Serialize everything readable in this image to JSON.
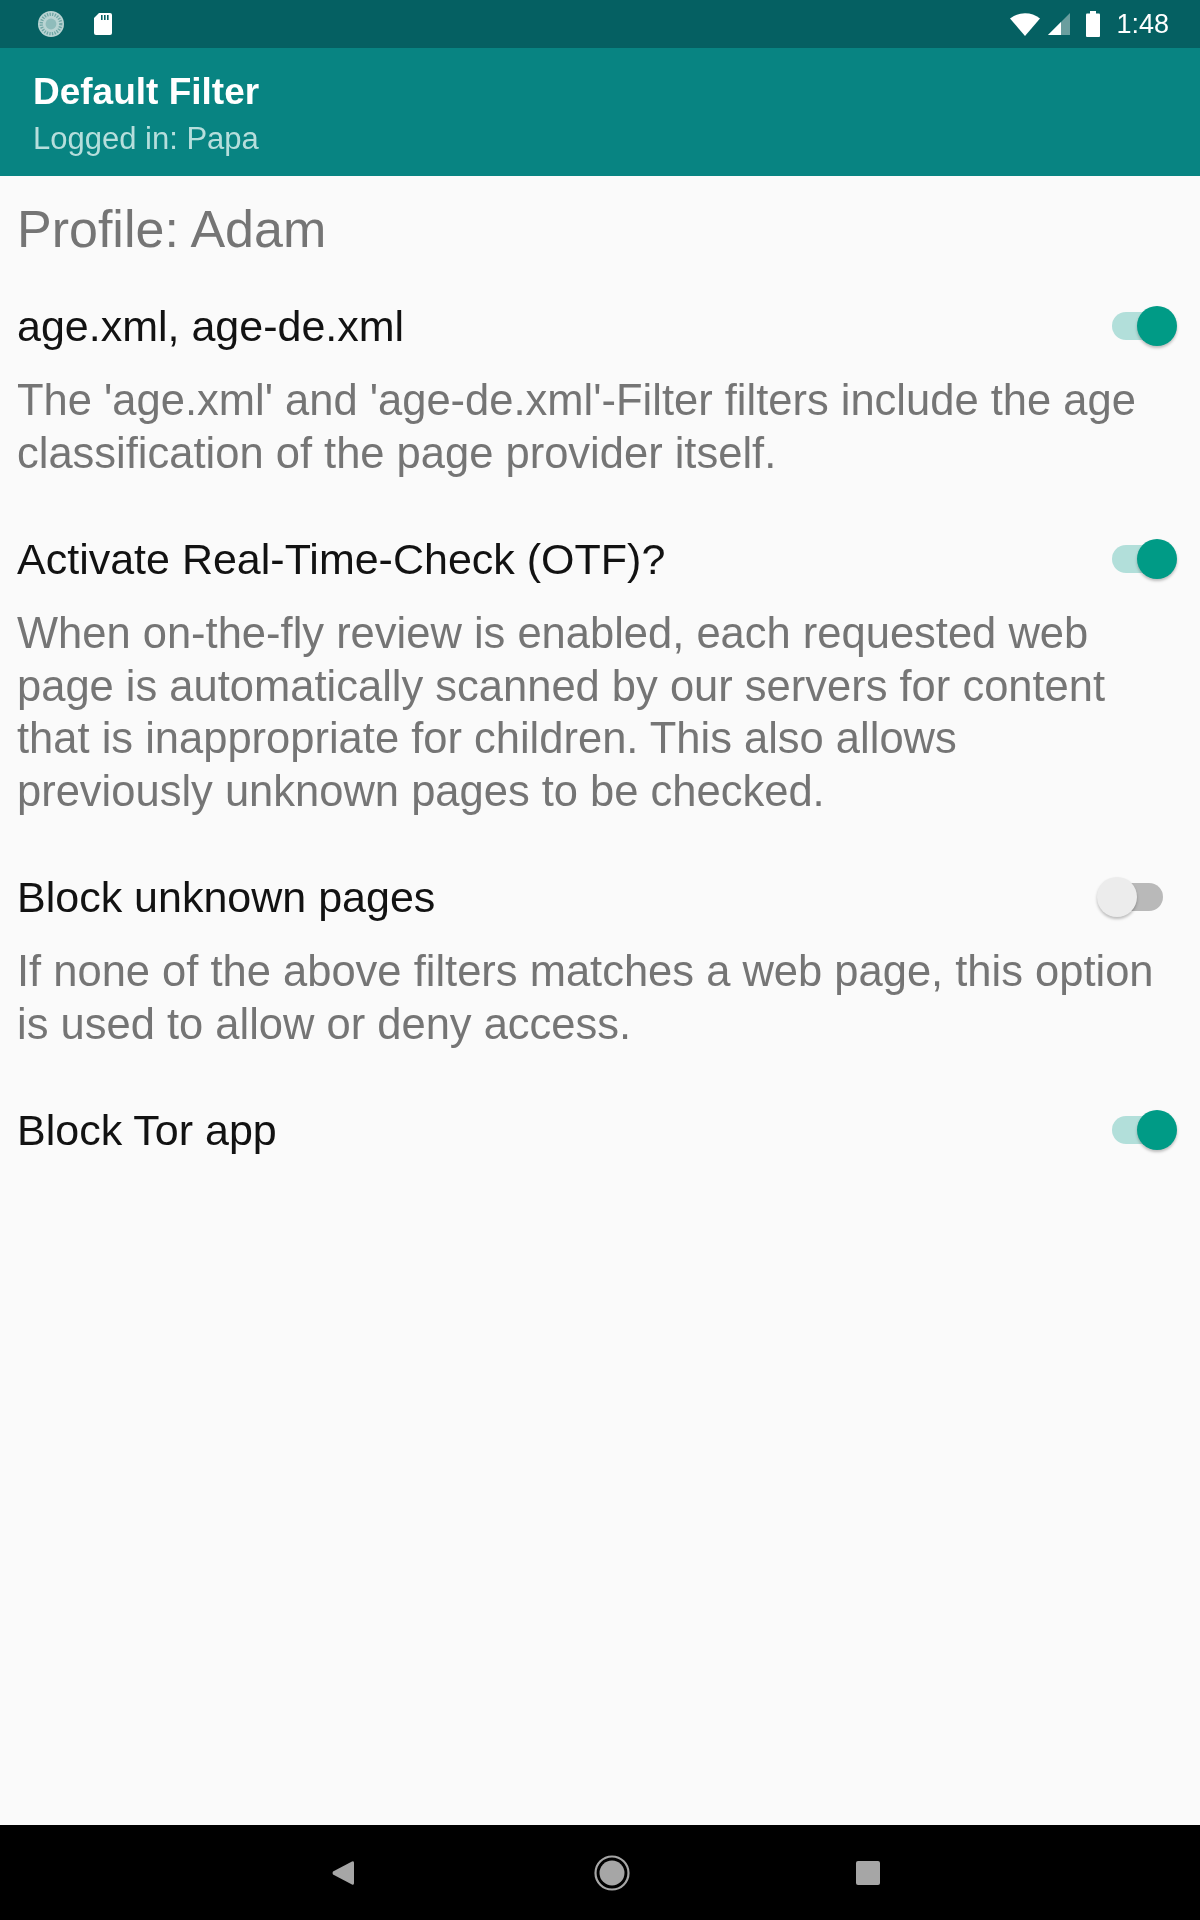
{
  "status_bar": {
    "time": "1:48"
  },
  "app_bar": {
    "title": "Default Filter",
    "subtitle": "Logged in: Papa"
  },
  "profile_heading": "Profile: Adam",
  "settings": [
    {
      "title": "age.xml, age-de.xml",
      "description": "The 'age.xml' and 'age-de.xml'-Filter filters include the age classification of the page provider itself.",
      "on": true
    },
    {
      "title": "Activate Real-Time-Check (OTF)?",
      "description": "When on-the-fly review is enabled, each requested web page is automatically scanned by our servers for content that is inappropriate for children. This also allows previously unknown pages to be checked.",
      "on": true
    },
    {
      "title": "Block unknown pages",
      "description": "If none of the above filters matches a web page, this option is used to allow or deny access.",
      "on": false
    },
    {
      "title": "Block Tor app",
      "on": true
    }
  ]
}
